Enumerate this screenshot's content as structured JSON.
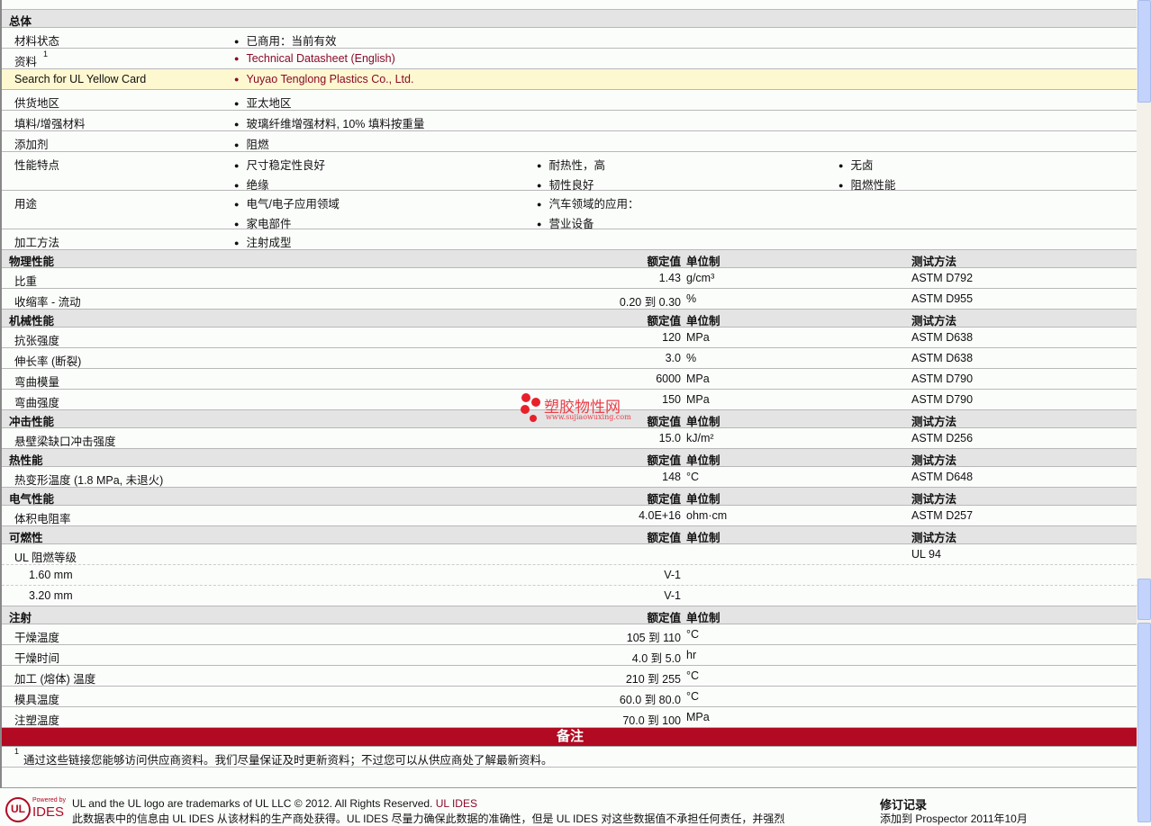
{
  "general": {
    "title": "总体",
    "rows": [
      {
        "label": "材料状态",
        "cols": [
          [
            "已商用：当前有效"
          ]
        ]
      },
      {
        "label": "资料",
        "sup": "1",
        "cols": [
          [
            "Technical Datasheet (English)"
          ]
        ],
        "link": true
      },
      {
        "label": "Search for UL Yellow Card",
        "cols": [
          [
            "Yuyao Tenglong Plastics Co., Ltd."
          ]
        ],
        "link": true,
        "highlight": true
      },
      {
        "label": "供货地区",
        "cols": [
          [
            "亚太地区"
          ]
        ]
      },
      {
        "label": "填料/增强材料",
        "cols": [
          [
            "玻璃纤维增强材料, 10% 填料按重量"
          ]
        ]
      },
      {
        "label": "添加剂",
        "cols": [
          [
            "阻燃"
          ]
        ]
      },
      {
        "label": "性能特点",
        "cols": [
          [
            "尺寸稳定性良好",
            "绝缘"
          ],
          [
            "耐热性，高",
            "韧性良好"
          ],
          [
            "无卤",
            "阻燃性能"
          ]
        ]
      },
      {
        "label": "用途",
        "cols": [
          [
            "电气/电子应用领域",
            "家电部件"
          ],
          [
            "汽车领域的应用：",
            "营业设备"
          ]
        ]
      },
      {
        "label": "加工方法",
        "cols": [
          [
            "注射成型"
          ]
        ]
      }
    ]
  },
  "headers": {
    "value": "额定值",
    "unit": "单位制",
    "method": "测试方法"
  },
  "sections": [
    {
      "title": "物理性能",
      "method": true,
      "rows": [
        [
          "比重",
          "1.43",
          "g/cm³",
          "ASTM D792"
        ],
        [
          "收缩率 - 流动",
          "0.20 到  0.30",
          "%",
          "ASTM D955"
        ]
      ]
    },
    {
      "title": "机械性能",
      "method": true,
      "rows": [
        [
          "抗张强度",
          "120",
          "MPa",
          "ASTM D638"
        ],
        [
          "伸长率 (断裂)",
          "3.0",
          "%",
          "ASTM D638"
        ],
        [
          "弯曲模量",
          "6000",
          "MPa",
          "ASTM D790"
        ],
        [
          "弯曲强度",
          "150",
          "MPa",
          "ASTM D790"
        ]
      ]
    },
    {
      "title": "冲击性能",
      "method": true,
      "rows": [
        [
          "悬壁梁缺口冲击强度",
          "15.0",
          "kJ/m²",
          "ASTM D256"
        ]
      ]
    },
    {
      "title": "热性能",
      "method": true,
      "rows": [
        [
          "热变形温度 (1.8 MPa, 未退火)",
          "148",
          "°C",
          "ASTM D648"
        ]
      ]
    },
    {
      "title": "电气性能",
      "method": true,
      "rows": [
        [
          "体积电阻率",
          "4.0E+16",
          "ohm·cm",
          "ASTM D257"
        ]
      ]
    },
    {
      "title": "可燃性",
      "method": true,
      "rows": [
        [
          "UL 阻燃等级",
          "",
          "",
          "UL 94"
        ],
        [
          "  1.60 mm",
          "V-1",
          "",
          ""
        ],
        [
          "  3.20 mm",
          "V-1",
          "",
          ""
        ]
      ]
    },
    {
      "title": "注射",
      "method": false,
      "rows": [
        [
          "干燥温度",
          "105 到  110",
          "°C",
          ""
        ],
        [
          "干燥时间",
          "4.0 到  5.0",
          "hr",
          ""
        ],
        [
          "加工 (熔体) 温度",
          "210 到  255",
          "°C",
          ""
        ],
        [
          "模具温度",
          "60.0 到  80.0",
          "°C",
          ""
        ],
        [
          "注塑温度",
          "70.0 到  100",
          "MPa",
          ""
        ]
      ]
    }
  ],
  "notes": {
    "title": "备注",
    "sup": "1",
    "text": "通过这些链接您能够访问供应商资料。我们尽量保证及时更新资料；不过您可以从供应商处了解最新资料。"
  },
  "footer": {
    "logo_small": "Powered by",
    "logo": "IDES",
    "line1": "UL and the UL logo are trademarks of UL LLC © 2012. All Rights Reserved.",
    "line1_link": "UL IDES",
    "line2": "此数据表中的信息由 UL IDES 从该材料的生产商处获得。UL IDES 尽量力确保此数据的准确性，但是 UL IDES 对这些数据值不承担任何责任，并强烈",
    "rev_title": "修订记录",
    "rev_text": "添加到 Prospector    2011年10月"
  },
  "watermark": {
    "name": "塑胶物性网",
    "url": "www.sujiaowuxing.com"
  }
}
